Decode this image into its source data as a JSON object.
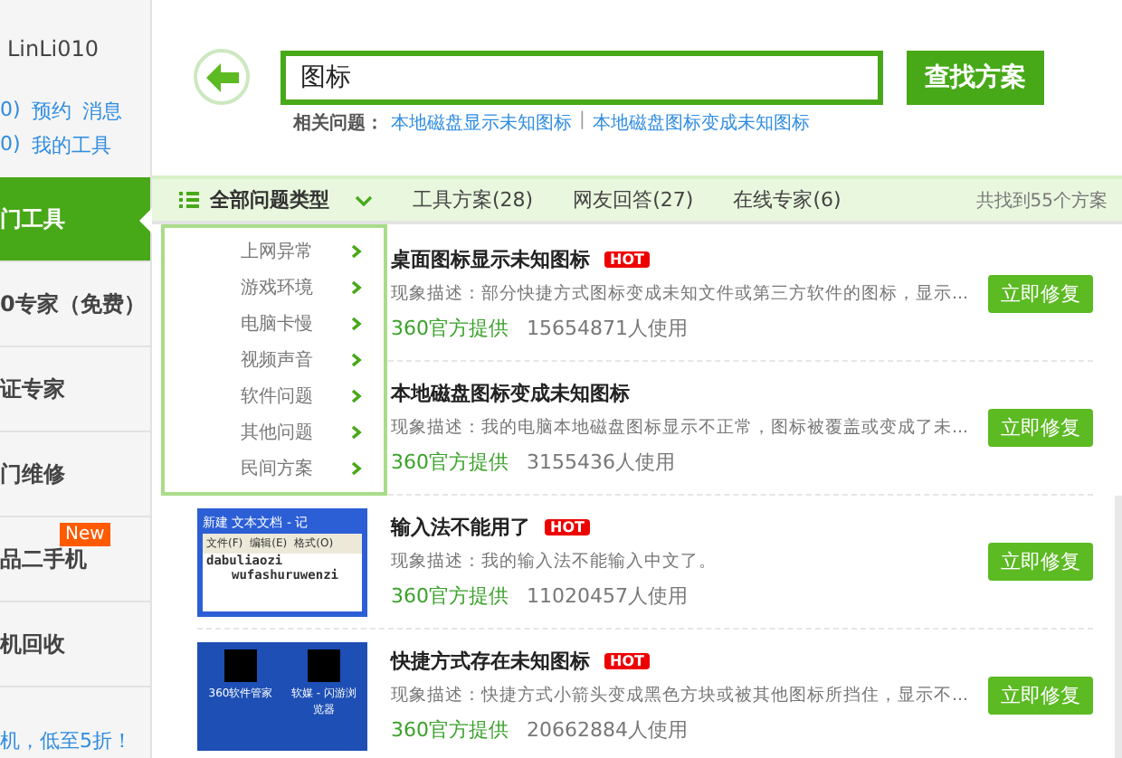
{
  "sidebar": {
    "username": "LinLi010",
    "links": [
      {
        "prefix": "0)",
        "items": [
          "预约",
          "消息"
        ]
      },
      {
        "prefix": "0)",
        "items": [
          "我的工具"
        ]
      }
    ],
    "nav": [
      {
        "label": "门工具",
        "selected": true
      },
      {
        "label": "0专家（免费）",
        "selected": false
      },
      {
        "label": "证专家",
        "selected": false
      },
      {
        "label": "门维修",
        "selected": false
      },
      {
        "label": "品二手机",
        "selected": false,
        "badge": "New"
      },
      {
        "label": "机回收",
        "selected": false
      }
    ],
    "promo": "机，低至5折！"
  },
  "search": {
    "value": "图标",
    "button": "查找方案"
  },
  "related": {
    "label": "相关问题：",
    "separator": "|",
    "links": [
      "本地磁盘显示未知图标",
      "本地磁盘图标变成未知图标"
    ]
  },
  "filters": {
    "type_menu": "全部问题类型",
    "tabs": [
      {
        "label": "工具方案(28)",
        "selected": false
      },
      {
        "label": "网友回答(27)",
        "selected": false
      },
      {
        "label": "在线专家(6)",
        "selected": false
      }
    ],
    "summary": "共找到55个方案"
  },
  "type_dropdown": {
    "expanded": true,
    "items": [
      "上网异常",
      "游戏环境",
      "电脑卡慢",
      "视频声音",
      "软件问题",
      "其他问题",
      "民间方案"
    ]
  },
  "results": [
    {
      "title": "桌面图标显示未知图标",
      "badge": "HOT",
      "description": "现象描述：部分快捷方式图标变成未知文件或第三方软件的图标，显示...",
      "provider": "360官方提供",
      "users": "15654871人使用",
      "action": "立即修复"
    },
    {
      "title": "本地磁盘图标变成未知图标",
      "description": "现象描述：我的电脑本地磁盘图标显示不正常，图标被覆盖或变成了未...",
      "provider": "360官方提供",
      "users": "3155436人使用",
      "action": "立即修复"
    },
    {
      "title": "输入法不能用了",
      "badge": "HOT",
      "description": "现象描述：我的输入法不能输入中文了。",
      "provider": "360官方提供",
      "users": "11020457人使用",
      "action": "立即修复",
      "thumbnail": {
        "kind": "notepad",
        "title": "新建 文本文档 - 记",
        "menus": [
          "文件(F)",
          "编辑(E)",
          "格式(O)"
        ],
        "lines": [
          "dabuliaozi",
          "wufashuruwenzi"
        ]
      }
    },
    {
      "title": "快捷方式存在未知图标",
      "badge": "HOT",
      "description": "现象描述：快捷方式小箭头变成黑色方块或被其他图标所挡住，显示不...",
      "provider": "360官方提供",
      "users": "20662884人使用",
      "action": "立即修复",
      "thumbnail": {
        "kind": "desktop",
        "icons": [
          "360软件管家",
          "软媒 - 闪游浏览器"
        ]
      }
    }
  ]
}
